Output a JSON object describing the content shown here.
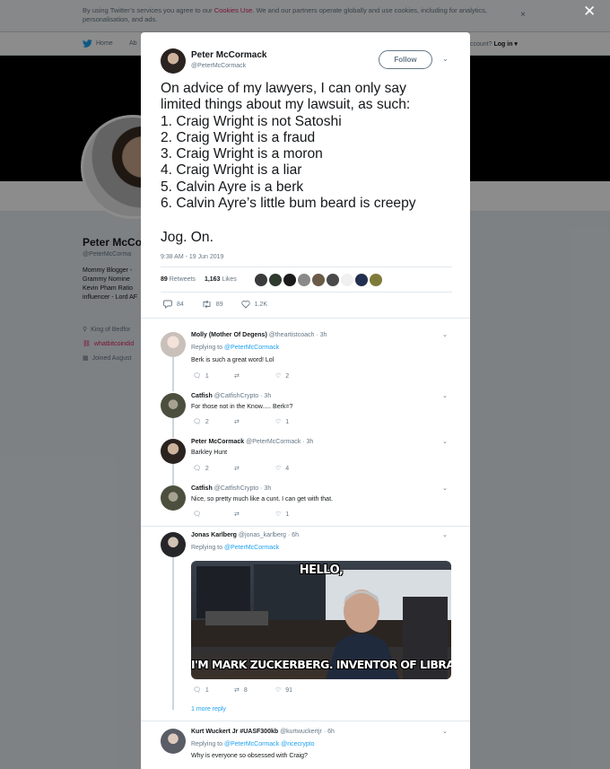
{
  "cookie_banner": {
    "text_before": "By using Twitter’s services you agree to our ",
    "link": "Cookies Use",
    "text_after": ". We and our partners operate globally and use cookies, including for analytics, personalisation, and ads.",
    "close_glyph": "×"
  },
  "topnav": {
    "home": "Home",
    "about": "Ab",
    "account_prompt": "ccount?",
    "login": "Log in ▾"
  },
  "profile": {
    "name": "Peter McCo",
    "handle": "@PeterMcCorma",
    "bio": "Mommy Blogger - Grammy Nomine Kevin Pham Ratio influencer - Lord AF",
    "location": "King of Bedfor",
    "website": "whatbitcoindid",
    "joined": "Joined August"
  },
  "overlay_close": "✕",
  "tweet": {
    "author_name": "Peter McCormack",
    "author_handle": "@PeterMcCormack",
    "follow_label": "Follow",
    "text": "On advice of my lawyers, I can only say\nlimited things about my lawsuit, as such:\n1. Craig Wright is not Satoshi\n2. Craig Wright is a fraud\n3. Craig Wright is a moron\n4. Craig Wright is a liar\n5. Calvin Ayre is a berk\n6. Calvin Ayre’s little bum beard is creepy",
    "signoff": "Jog. On.",
    "timestamp": "9:38 AM - 19 Jun 2019",
    "retweets_count": "89",
    "retweets_label": "Retweets",
    "likes_count": "1,163",
    "likes_label": "Likes",
    "reply_count": "84",
    "retweet_count": "89",
    "like_count": "1.2K"
  },
  "replies": [
    {
      "name": "Molly (Mother Of Degens)",
      "handle": "@theartistcoach",
      "time": "· 3h",
      "replying_label": "Replying to",
      "replying_to": "@PeterMcCormack",
      "text": "Berk is such a great word! Lol",
      "replies": "1",
      "retweets": "",
      "likes": "2"
    },
    {
      "name": "Catfish",
      "handle": "@CatfishCrypto",
      "time": "· 3h",
      "text": "For those not in the Know..... Berk=?",
      "replies": "2",
      "retweets": "",
      "likes": "1"
    },
    {
      "name": "Peter McCormack",
      "handle": "@PeterMcCormack",
      "time": "· 3h",
      "text": "Barkley Hunt",
      "replies": "2",
      "retweets": "",
      "likes": "4"
    },
    {
      "name": "Catfish",
      "handle": "@CatfishCrypto",
      "time": "· 3h",
      "text": "Nice, so pretty much like a cunt. I can get with that.",
      "replies": "",
      "retweets": "",
      "likes": "1"
    },
    {
      "name": "Jonas Karlberg",
      "handle": "@jonas_karlberg",
      "time": "· 6h",
      "replying_label": "Replying to",
      "replying_to": "@PeterMcCormack",
      "meme_top": "HELLO,",
      "meme_bottom": "I'M MARK ZUCKERBERG. INVENTOR OF LIBRA",
      "replies": "1",
      "retweets": "8",
      "likes": "91",
      "more": "1 more reply"
    },
    {
      "name": "Kurt Wuckert Jr #UASF300kb",
      "handle": "@kurtwuckertjr",
      "time": "· 6h",
      "replying_label": "Replying to",
      "replying_to": "@PeterMcCormack @ricecrypto",
      "text": "Why is everyone so obsessed with Craig?"
    }
  ],
  "colors": {
    "twitter_blue": "#1da1f2",
    "like_red": "#e0245e",
    "muted": "#657786"
  }
}
